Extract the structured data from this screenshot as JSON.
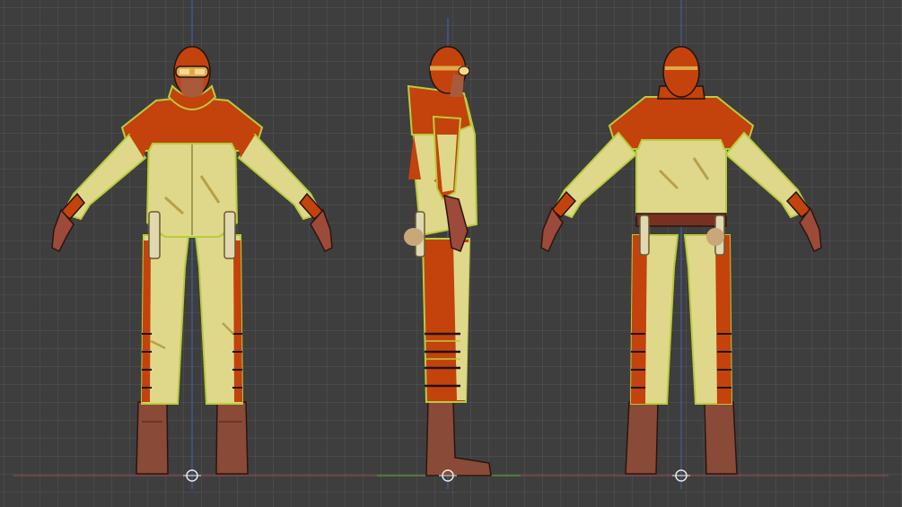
{
  "viewport": {
    "background": "#3e3e3e",
    "grid_color": "#4a4a4a",
    "floor_axis_color": "#8a4848",
    "vertical_axis_color": "#3e5f9e",
    "depth_axis_color": "#4e8a3a"
  },
  "character": {
    "views": [
      "front",
      "side",
      "back"
    ],
    "colors": {
      "suit_orange": "#c4420c",
      "suit_cream": "#dfd88a",
      "outline_lime": "#b8cc3c",
      "skin": "#a85a3a",
      "boots": "#8a4a38",
      "belt": "#7a3020",
      "goggles": "#e0a84a",
      "outline_dark": "#1f1410"
    }
  },
  "gizmos": {
    "origin_marker": "origin-circle-icon"
  }
}
